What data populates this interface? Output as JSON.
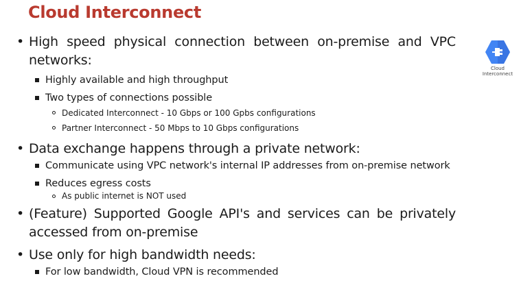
{
  "slide": {
    "title": "Cloud Interconnect"
  },
  "icon": {
    "name": "cloud-interconnect-icon",
    "caption_line1": "Cloud",
    "caption_line2": "Interconnect",
    "color_primary": "#4285f4",
    "color_dark": "#3367d6"
  },
  "bullets": {
    "b1": {
      "text": "High speed physical connection between on-premise and VPC networks:",
      "sub1": "Highly available and high throughput",
      "sub2": "Two types of connections possible",
      "sub2_a": "Dedicated Interconnect - 10 Gbps or 100 Gpbs configurations",
      "sub2_b": "Partner Interconnect - 50 Mbps to 10 Gbps configurations"
    },
    "b2": {
      "text": "Data exchange happens through a private network:",
      "sub1": "Communicate using VPC network's internal IP addresses from on-premise network",
      "sub2": "Reduces egress costs",
      "sub2_a": "As public internet is NOT used"
    },
    "b3": {
      "text": "(Feature) Supported Google API's and services can be privately accessed from on-premise"
    },
    "b4": {
      "text": "Use only for high bandwidth needs:",
      "sub1": "For low bandwidth, Cloud VPN is recommended"
    }
  }
}
